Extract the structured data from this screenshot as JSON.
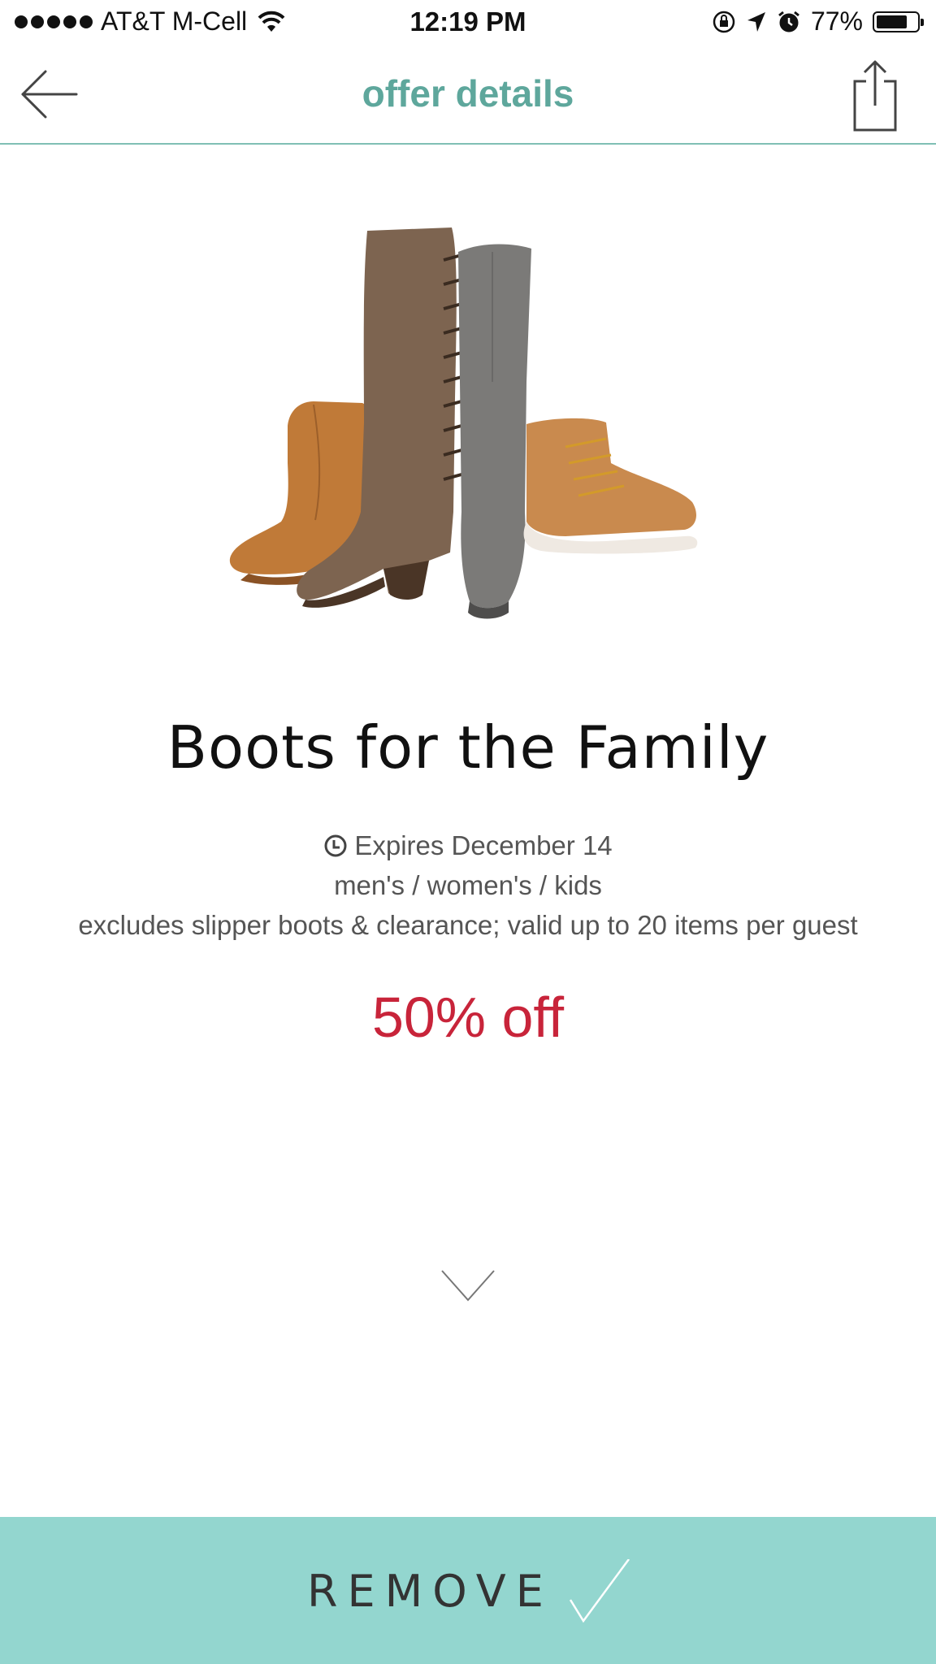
{
  "status_bar": {
    "carrier": "AT&T M-Cell",
    "time": "12:19 PM",
    "battery_percent": "77%",
    "battery_level": 0.77,
    "icons": [
      "signal-dots-icon",
      "wifi-icon",
      "rotation-lock-icon",
      "location-arrow-icon",
      "alarm-icon",
      "battery-icon"
    ]
  },
  "nav": {
    "title": "offer details",
    "back_icon": "arrow-left-icon",
    "share_icon": "share-icon"
  },
  "offer": {
    "image": "boots-product-image",
    "title": "Boots for the Family",
    "expires": "Expires December 14",
    "categories": "men's / women's / kids",
    "terms": "excludes slipper boots & clearance; valid up to 20 items per guest",
    "discount": "50% off"
  },
  "action": {
    "label": "REMOVE",
    "icon": "checkmark-icon",
    "color": "#93d6cf"
  },
  "colors": {
    "accent": "#5ea79c",
    "discount": "#c8243a",
    "divider": "#7fbfb4"
  }
}
